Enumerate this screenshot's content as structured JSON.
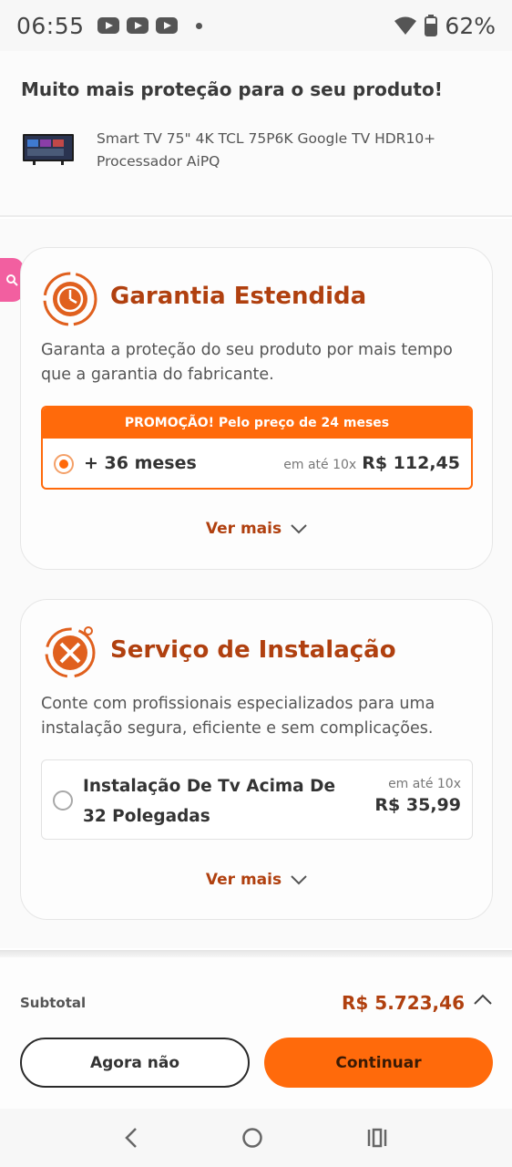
{
  "status_bar": {
    "time": "06:55",
    "battery": "62%"
  },
  "header": {
    "title": "Muito mais proteção para o seu produto!",
    "product_name": "Smart TV 75\" 4K TCL 75P6K Google TV HDR10+ Processador AiPQ"
  },
  "warranty": {
    "title": "Garantia Estendida",
    "description": "Garanta a proteção do seu produto por mais tempo que a garantia do fabricante.",
    "promo_banner": "PROMOÇÃO! Pelo preço de 24 meses",
    "option_label": "+ 36 meses",
    "installments": "em até 10x",
    "price": "R$ 112,45",
    "selected": true,
    "see_more": "Ver mais"
  },
  "installation": {
    "title": "Serviço de Instalação",
    "description": "Conte com profissionais especializados para uma instalação segura, eficiente e sem complicações.",
    "option_label": "Instalação De Tv Acima De 32 Polegadas",
    "installments": "em até 10x",
    "price": "R$ 35,99",
    "selected": false,
    "see_more": "Ver mais"
  },
  "footer": {
    "subtotal_label": "Subtotal",
    "subtotal_value": "R$ 5.723,46",
    "secondary_button": "Agora não",
    "primary_button": "Continuar"
  },
  "colors": {
    "accent": "#ff6a0b",
    "title_brown": "#b0400f",
    "side_tab": "#f25fa0"
  },
  "icons": [
    "youtube-icon",
    "wifi-icon",
    "battery-icon",
    "shield-clock-icon",
    "tools-icon",
    "chevron-down-icon",
    "chevron-up-icon",
    "search-icon",
    "back-icon",
    "home-icon",
    "recents-icon"
  ]
}
